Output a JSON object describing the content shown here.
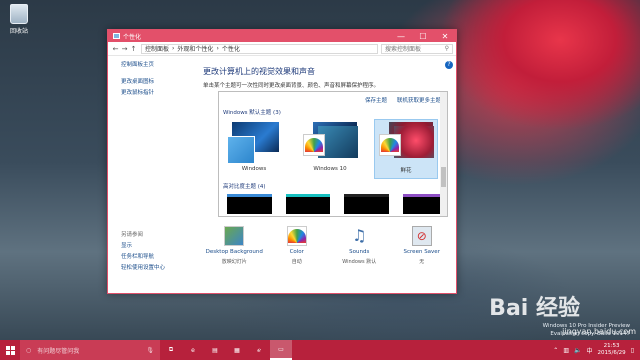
{
  "desktop": {
    "icon_label": "回收站"
  },
  "window": {
    "title": "个性化",
    "buttons": {
      "minimize": "—",
      "maximize": "☐",
      "close": "✕"
    },
    "breadcrumb": [
      "控制面板",
      "外观和个性化",
      "个性化"
    ],
    "search_placeholder": "搜索控制面板",
    "left_links": [
      "控制面板主页",
      "更改桌面图标",
      "更改鼠标指针"
    ],
    "see_also_heading": "另请参阅",
    "see_also_links": [
      "显示",
      "任务栏和导航",
      "轻松使用设置中心"
    ],
    "heading": "更改计算机上的视觉效果和声音",
    "subtext": "单击某个主题可一次性同时更改桌面背景、颜色、声音和屏幕保护程序。",
    "actions": [
      "保存主题",
      "联机获取更多主题"
    ],
    "windows_group": "Windows 默认主题 (3)",
    "themes": [
      {
        "label": "Windows"
      },
      {
        "label": "Windows 10"
      },
      {
        "label": "鲜花"
      }
    ],
    "hc_group": "高对比度主题 (4)",
    "bottom": [
      {
        "name": "Desktop Background",
        "value": "放映幻灯片"
      },
      {
        "name": "Color",
        "value": "自动"
      },
      {
        "name": "Sounds",
        "value": "Windows 默认"
      },
      {
        "name": "Screen Saver",
        "value": "无"
      }
    ]
  },
  "taskbar": {
    "search_placeholder": "有问题尽管问我",
    "time": "21:53",
    "date": "2015/6/29"
  },
  "build": {
    "line1": "Windows 10 Pro Insider Preview",
    "line2": "Evaluation copy. Build 10147"
  },
  "watermark": {
    "brand": "Bai 经验",
    "url": "jingyan.baidu.com"
  }
}
